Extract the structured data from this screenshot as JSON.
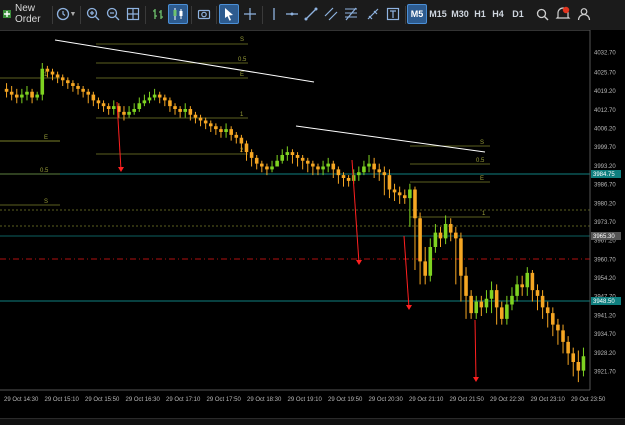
{
  "toolbar": {
    "new_order_label": "New Order",
    "timeframes": [
      "M5",
      "M15",
      "M30",
      "H1",
      "H4",
      "D1"
    ],
    "active_timeframe": "M5",
    "icons": [
      "new-order-icon",
      "clock-icon",
      "zoom-in-icon",
      "zoom-out-icon",
      "grid-icon",
      "bar-chart-icon",
      "candle-chart-icon",
      "screenshot-icon",
      "cursor-icon",
      "crosshair-icon",
      "vertical-line-icon",
      "horizontal-line-icon",
      "trendline-icon",
      "channel-icon",
      "fibonacci-icon",
      "text-tool-icon",
      "shapes-icon",
      "search-icon",
      "notifications-icon",
      "user-icon"
    ]
  },
  "colors": {
    "background": "#000000",
    "bull_candle": "#7ed321",
    "bear_candle": "#f5a623",
    "level_line": "#7a7f2a",
    "trendline": "#ffffff",
    "arrow": "#ff2020",
    "teal_level": "#0f7f7f",
    "red_dashed": "#b01010",
    "axis_text": "#b8b8b8"
  },
  "price_axis": {
    "labels": [
      "4032.70",
      "4025.70",
      "4019.20",
      "4012.70",
      "4006.20",
      "3999.70",
      "3993.20",
      "3986.70",
      "3980.20",
      "3973.70",
      "3967.20",
      "3960.70",
      "3954.20",
      "3947.70",
      "3941.20",
      "3934.70",
      "3928.20",
      "3921.70"
    ],
    "current_price_tag": "3984.75",
    "tag_2": "3965.30",
    "tag_3": "3948.50"
  },
  "time_axis": {
    "labels": [
      "29 Oct 14:30",
      "29 Oct 15:10",
      "29 Oct 15:50",
      "29 Oct 16:30",
      "29 Oct 17:10",
      "29 Oct 17:50",
      "29 Oct 18:30",
      "29 Oct 19:10",
      "29 Oct 19:50",
      "29 Oct 20:30",
      "29 Oct 21:10",
      "29 Oct 21:50",
      "29 Oct 22:30",
      "29 Oct 23:10",
      "29 Oct 23:50"
    ]
  },
  "level_labels": {
    "s": "S",
    "half": "0.5",
    "e": "E",
    "one": "1",
    "two": "2"
  },
  "chart_data": {
    "type": "candlestick",
    "symbol": "",
    "timeframe": "M5",
    "ylim": [
      3917,
      4037
    ],
    "x": [
      "14:30",
      "14:35",
      "14:40",
      "14:45",
      "14:50",
      "14:55",
      "15:00",
      "15:05",
      "15:10",
      "15:15",
      "15:20",
      "15:25",
      "15:30",
      "15:35",
      "15:40",
      "15:45",
      "15:50",
      "15:55",
      "16:00",
      "16:05",
      "16:10",
      "16:15",
      "16:20",
      "16:25",
      "16:30",
      "16:35",
      "16:40",
      "16:45",
      "16:50",
      "16:55",
      "17:00",
      "17:05",
      "17:10",
      "17:15",
      "17:20",
      "17:25",
      "17:30",
      "17:35",
      "17:40",
      "17:45",
      "17:50",
      "17:55",
      "18:00",
      "18:05",
      "18:10",
      "18:15",
      "18:20",
      "18:25",
      "18:30",
      "18:35",
      "18:40",
      "18:45",
      "18:50",
      "18:55",
      "19:00",
      "19:05",
      "19:10",
      "19:15",
      "19:20",
      "19:25",
      "19:30",
      "19:35",
      "19:40",
      "19:45",
      "19:50",
      "19:55",
      "20:00",
      "20:05",
      "20:10",
      "20:15",
      "20:20",
      "20:25",
      "20:30",
      "20:35",
      "20:40",
      "20:45",
      "20:50",
      "20:55",
      "21:00",
      "21:05",
      "21:10",
      "21:15",
      "21:20",
      "21:25",
      "21:30",
      "21:35",
      "21:40",
      "21:45",
      "21:50",
      "21:55",
      "22:00",
      "22:05",
      "22:10",
      "22:15",
      "22:20",
      "22:25",
      "22:30",
      "22:35",
      "22:40",
      "22:45",
      "22:50",
      "22:55",
      "23:00",
      "23:05",
      "23:10",
      "23:15",
      "23:20",
      "23:25",
      "23:30",
      "23:35",
      "23:40",
      "23:45",
      "23:50",
      "23:55"
    ],
    "open": [
      4020,
      4019,
      4018,
      4017,
      4018,
      4019,
      4017,
      4018,
      4027,
      4026,
      4025,
      4024,
      4023,
      4022,
      4021,
      4020,
      4019,
      4018,
      4016,
      4015,
      4014,
      4013,
      4014,
      4012,
      4011,
      4012,
      4013,
      4015,
      4016,
      4017,
      4018,
      4017,
      4016,
      4014,
      4013,
      4012,
      4013,
      4011,
      4010,
      4009,
      4008,
      4007,
      4006,
      4005,
      4006,
      4004,
      4003,
      4001,
      3998,
      3996,
      3994,
      3993,
      3992,
      3993,
      3995,
      3997,
      3998,
      3997,
      3996,
      3995,
      3994,
      3993,
      3992,
      3993,
      3994,
      3992,
      3990,
      3989,
      3988,
      3990,
      3991,
      3993,
      3994,
      3992,
      3991,
      3990,
      3985,
      3984,
      3983,
      3982,
      3985,
      3975,
      3960,
      3955,
      3965,
      3970,
      3968,
      3973,
      3970,
      3968,
      3955,
      3948,
      3942,
      3946,
      3944,
      3947,
      3950,
      3944,
      3940,
      3945,
      3948,
      3952,
      3951,
      3956,
      3950,
      3948,
      3944,
      3942,
      3938,
      3936,
      3932,
      3928,
      3925,
      3922
    ],
    "close": [
      4019,
      4018,
      4017,
      4018,
      4019,
      4017,
      4018,
      4027,
      4026,
      4025,
      4024,
      4023,
      4022,
      4021,
      4020,
      4019,
      4018,
      4016,
      4015,
      4014,
      4013,
      4014,
      4012,
      4011,
      4012,
      4013,
      4015,
      4016,
      4017,
      4018,
      4017,
      4016,
      4014,
      4013,
      4012,
      4013,
      4011,
      4010,
      4009,
      4008,
      4007,
      4006,
      4005,
      4006,
      4004,
      4003,
      4001,
      3998,
      3996,
      3994,
      3993,
      3992,
      3993,
      3995,
      3997,
      3998,
      3997,
      3996,
      3995,
      3994,
      3993,
      3992,
      3993,
      3994,
      3992,
      3990,
      3989,
      3988,
      3990,
      3991,
      3993,
      3994,
      3992,
      3991,
      3990,
      3985,
      3984,
      3983,
      3982,
      3985,
      3975,
      3960,
      3955,
      3965,
      3970,
      3968,
      3973,
      3970,
      3968,
      3955,
      3948,
      3942,
      3946,
      3944,
      3947,
      3950,
      3944,
      3940,
      3945,
      3948,
      3952,
      3951,
      3956,
      3950,
      3948,
      3944,
      3942,
      3938,
      3936,
      3932,
      3928,
      3925,
      3922,
      3927
    ],
    "high": [
      4022,
      4021,
      4020,
      4020,
      4021,
      4020,
      4019,
      4029,
      4028,
      4027,
      4026,
      4025,
      4024,
      4023,
      4022,
      4021,
      4020,
      4019,
      4017,
      4016,
      4015,
      4016,
      4015,
      4014,
      4014,
      4015,
      4017,
      4018,
      4019,
      4020,
      4019,
      4018,
      4017,
      4015,
      4014,
      4015,
      4014,
      4012,
      4011,
      4010,
      4009,
      4008,
      4007,
      4008,
      4007,
      4005,
      4004,
      4002,
      3999,
      3997,
      3995,
      3994,
      3995,
      3997,
      3999,
      4000,
      3999,
      3998,
      3997,
      3996,
      3995,
      3994,
      3995,
      3996,
      3995,
      3993,
      3991,
      3990,
      3992,
      3993,
      3995,
      3997,
      3996,
      3994,
      3993,
      3992,
      3987,
      3986,
      3985,
      3987,
      3986,
      3977,
      3965,
      3968,
      3973,
      3972,
      3976,
      3975,
      3972,
      3970,
      3958,
      3950,
      3948,
      3948,
      3950,
      3953,
      3952,
      3946,
      3948,
      3951,
      3955,
      3955,
      3958,
      3957,
      3952,
      3950,
      3946,
      3944,
      3940,
      3938,
      3934,
      3930,
      3929,
      3930
    ],
    "low": [
      4017,
      4016,
      4015,
      4015,
      4016,
      4015,
      4016,
      4016,
      4024,
      4023,
      4022,
      4021,
      4020,
      4019,
      4018,
      4017,
      4015,
      4014,
      4013,
      4012,
      4011,
      4011,
      4010,
      4009,
      4010,
      4011,
      4012,
      4014,
      4015,
      4016,
      4015,
      4014,
      4012,
      4011,
      4010,
      4010,
      4009,
      4008,
      4007,
      4006,
      4005,
      4004,
      4003,
      4003,
      4002,
      4001,
      3998,
      3995,
      3993,
      3992,
      3991,
      3990,
      3991,
      3993,
      3994,
      3995,
      3994,
      3993,
      3992,
      3991,
      3990,
      3990,
      3990,
      3991,
      3989,
      3987,
      3986,
      3986,
      3987,
      3988,
      3990,
      3991,
      3989,
      3988,
      3983,
      3982,
      3981,
      3980,
      3980,
      3972,
      3957,
      3952,
      3952,
      3953,
      3963,
      3965,
      3966,
      3967,
      3952,
      3946,
      3940,
      3940,
      3940,
      3941,
      3942,
      3942,
      3938,
      3938,
      3938,
      3943,
      3946,
      3948,
      3948,
      3946,
      3943,
      3940,
      3937,
      3934,
      3931,
      3928,
      3924,
      3920,
      3918,
      3920
    ]
  }
}
